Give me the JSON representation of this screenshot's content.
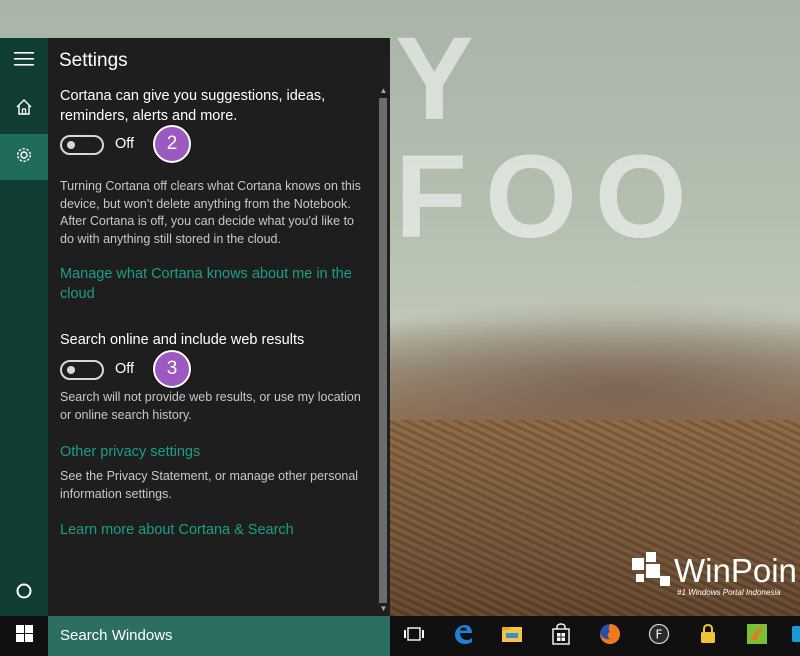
{
  "background": {
    "big_text": "Y FOO",
    "watermark": {
      "name": "WinPoin",
      "tagline": "#1 Windows Portal Indonesia"
    }
  },
  "rail": {
    "items": [
      {
        "icon": "hamburger-menu-icon"
      },
      {
        "icon": "home-icon"
      },
      {
        "icon": "gear-icon",
        "active": true
      },
      {
        "icon": "cortana-circle-icon"
      }
    ]
  },
  "settings": {
    "title": "Settings",
    "cortana_toggle": {
      "label": "Cortana can give you suggestions, ideas, reminders, alerts and more.",
      "state": "Off",
      "badge": "2",
      "description": "Turning Cortana off clears what Cortana knows on this device, but won't delete anything from the Notebook. After Cortana is off, you can decide what you'd like to do with anything still stored in the cloud."
    },
    "manage_link": "Manage what Cortana knows about me in the cloud",
    "web_toggle": {
      "label": "Search online and include web results",
      "state": "Off",
      "badge": "3",
      "description": "Search will not provide web results, or use my location or online search history."
    },
    "privacy_link": "Other privacy settings",
    "privacy_description": "See the Privacy Statement, or manage other personal information settings.",
    "learn_more_link": "Learn more about Cortana & Search"
  },
  "taskbar": {
    "search_placeholder": "Search Windows",
    "icons": [
      "task-view-icon",
      "edge-icon",
      "file-explorer-icon",
      "store-icon",
      "firefox-icon",
      "f-app-icon",
      "lock-icon",
      "app-icon",
      "partial-icon"
    ]
  },
  "colors": {
    "accent": "#1b9e87",
    "rail_bg": "#0f3d34",
    "rail_active": "#1f6b5c",
    "panel_bg": "#1e1e1e",
    "search_bg": "#2d6e62",
    "badge": "#9b59c1"
  }
}
